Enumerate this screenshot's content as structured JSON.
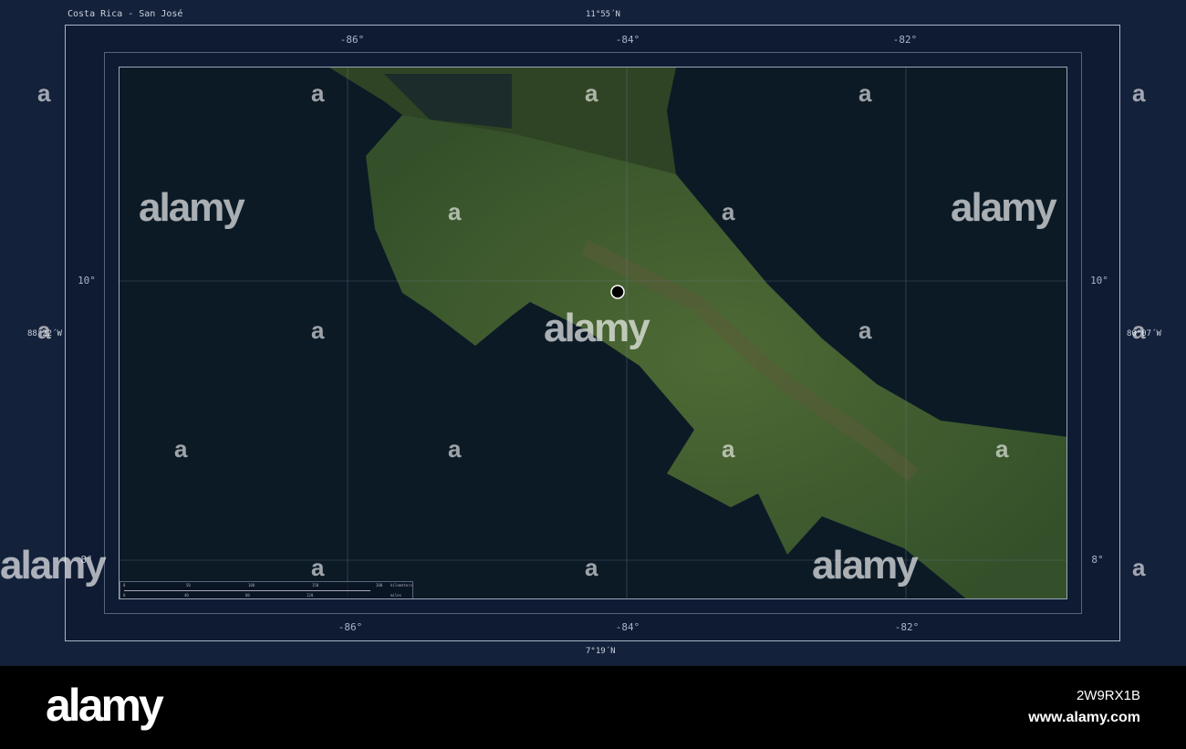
{
  "title": "Costa Rica - San José",
  "lat_top": "11°55´N",
  "lat_bottom": "7°19´N",
  "lon_left": "88°22´W",
  "lon_right": "80°07´W",
  "lon_ticks": [
    "-86°",
    "-84°",
    "-82°"
  ],
  "lat_ticks": [
    "10°",
    "8°"
  ],
  "scale": {
    "km": [
      "0",
      "50",
      "100",
      "150",
      "200"
    ],
    "km_unit": "kilometers",
    "mi": [
      "0",
      "40",
      "80",
      "120"
    ],
    "mi_unit": "miles"
  },
  "marker": "San José",
  "watermark": "alamy",
  "footer": {
    "logo": "alamy",
    "image_id": "2W9RX1B",
    "url": "www.alamy.com"
  },
  "colors": {
    "background": "#14213a",
    "sea": "#0c1a26",
    "land": "#3f5f2c"
  }
}
